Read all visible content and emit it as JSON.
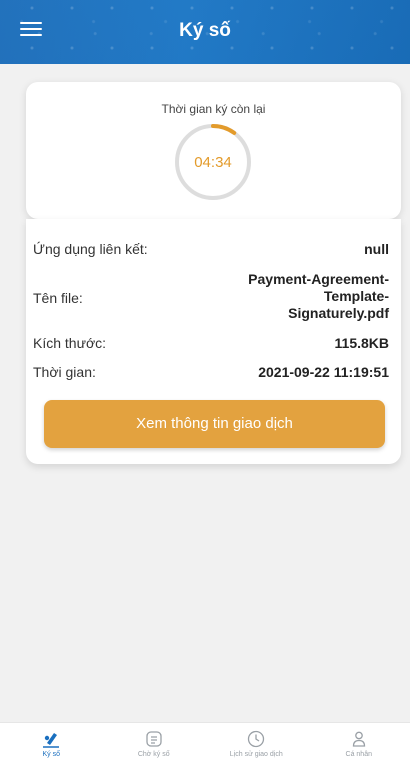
{
  "header": {
    "title": "Ký số",
    "menu_icon": "hamburger-menu-icon"
  },
  "timer": {
    "label": "Thời gian ký còn lại",
    "value": "04:34",
    "progress_fraction": 0.1,
    "ring_color": "#e39b2b",
    "track_color": "#dddddd"
  },
  "info": {
    "app_label": "Ứng dụng liên kết:",
    "app_value": "null",
    "file_label": "Tên file:",
    "file_value_lines": [
      "Payment-Agreement-",
      "Template-",
      "Signaturely.pdf"
    ],
    "size_label": "Kích thước:",
    "size_value": "115.8KB",
    "time_label": "Thời gian:",
    "time_value": "2021-09-22 11:19:51"
  },
  "cta": {
    "label": "Xem thông tin giao dịch",
    "color": "#e3a23f"
  },
  "nav": {
    "items": [
      {
        "label": "Ký số",
        "icon": "sign-pen-icon",
        "active": true
      },
      {
        "label": "Chờ ký số",
        "icon": "pending-list-icon",
        "active": false
      },
      {
        "label": "Lịch sử giao dịch",
        "icon": "clock-history-icon",
        "active": false
      },
      {
        "label": "Cá nhân",
        "icon": "user-profile-icon",
        "active": false
      }
    ],
    "active_color": "#1a6fbf",
    "inactive_color": "#9aa0a6"
  }
}
